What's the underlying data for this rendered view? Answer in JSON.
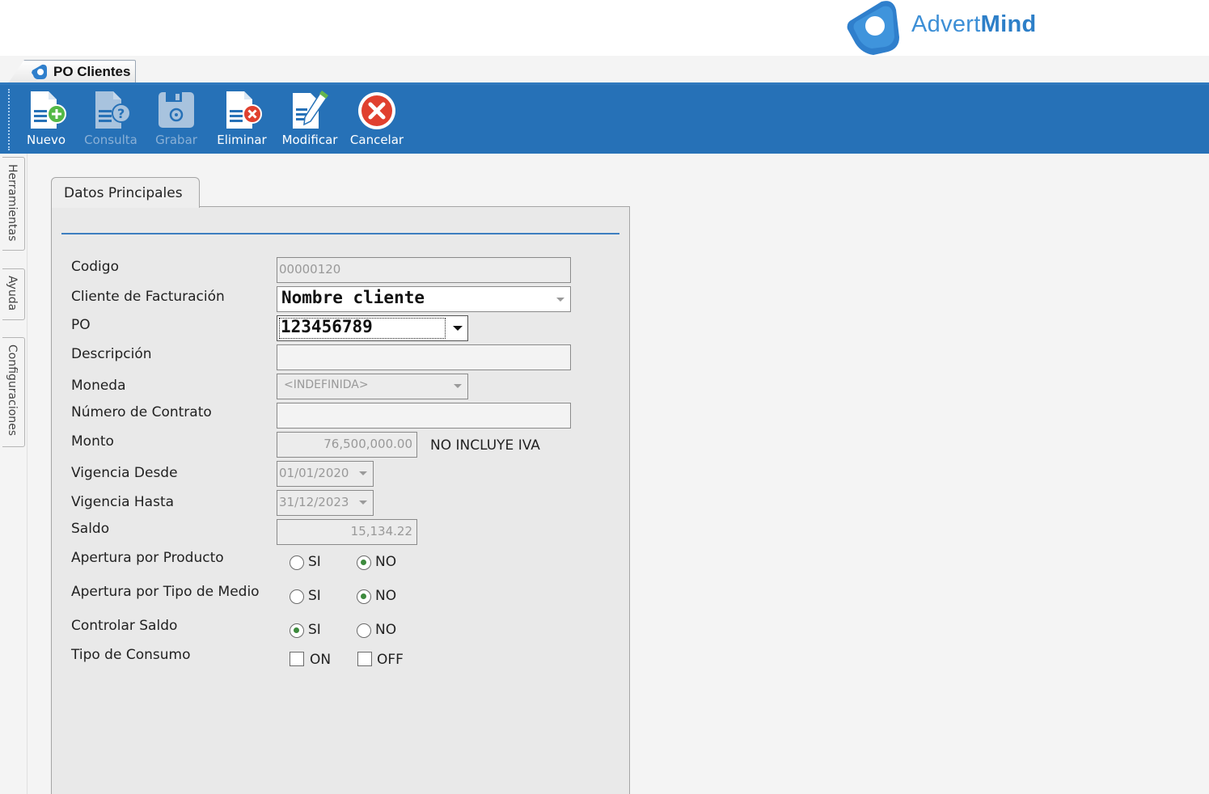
{
  "brand": {
    "name_light": "Advert",
    "name_bold": "Mind",
    "color": "#3d8fd6"
  },
  "window_tab": {
    "label": "PO Clientes"
  },
  "toolbar": {
    "color": "#2671b7",
    "buttons": [
      {
        "label": "Nuevo",
        "icon": "new-document-icon",
        "enabled": true
      },
      {
        "label": "Consulta",
        "icon": "query-document-icon",
        "enabled": false
      },
      {
        "label": "Grabar",
        "icon": "save-disk-icon",
        "enabled": false
      },
      {
        "label": "Eliminar",
        "icon": "delete-document-icon",
        "enabled": true
      },
      {
        "label": "Modificar",
        "icon": "edit-document-icon",
        "enabled": true
      },
      {
        "label": "Cancelar",
        "icon": "cancel-circle-icon",
        "enabled": true
      }
    ]
  },
  "side_tabs": [
    "Herramientas",
    "Ayuda",
    "Configuraciones"
  ],
  "form": {
    "tab_label": "Datos Principales",
    "labels": {
      "codigo": "Codigo",
      "cliente": "Cliente de Facturación",
      "po": "PO",
      "descripcion": "Descripción",
      "moneda": "Moneda",
      "contrato": "Número de Contrato",
      "monto": "Monto",
      "vigencia_desde": "Vigencia Desde",
      "vigencia_hasta": "Vigencia Hasta",
      "saldo": "Saldo",
      "apertura_producto": "Apertura por Producto",
      "apertura_medio": "Apertura por Tipo de Medio",
      "controlar_saldo": "Controlar Saldo",
      "tipo_consumo": "Tipo de Consumo"
    },
    "values": {
      "codigo": "00000120",
      "cliente": "Nombre cliente",
      "po": "123456789",
      "descripcion": "",
      "moneda": "<INDEFINIDA>",
      "contrato": "",
      "monto": "76,500,000.00",
      "monto_note": "NO INCLUYE IVA",
      "vigencia_desde": "01/01/2020",
      "vigencia_hasta": "31/12/2023",
      "saldo": "15,134.22"
    },
    "options": {
      "si": "SI",
      "no": "NO",
      "on": "ON",
      "off": "OFF"
    },
    "state": {
      "apertura_producto": "NO",
      "apertura_medio": "NO",
      "controlar_saldo": "SI",
      "tipo_consumo_on": false,
      "tipo_consumo_off": false
    }
  }
}
